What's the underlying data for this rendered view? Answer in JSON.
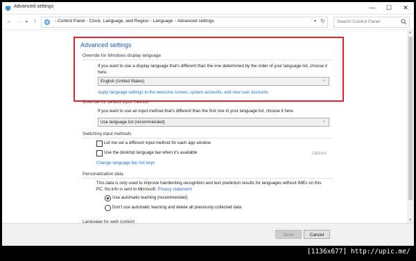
{
  "window": {
    "title": "Advanced settings"
  },
  "address_bar": {
    "breadcrumbs": [
      "Control Panel",
      "Clock, Language, and Region",
      "Language",
      "Advanced settings"
    ],
    "search_placeholder": "Search Control Panel"
  },
  "main": {
    "heading": "Advanced settings",
    "display_language": {
      "title": "Override for Windows display language",
      "description": "If you want to use a display language that's different than the one determined by the order of your language list, choose it here.",
      "selected": "English (United States)",
      "link": "Apply language settings to the welcome screen, system accounts, and new user accounts"
    },
    "input_method": {
      "title": "Override for default input method",
      "description": "If you want to use an input method that's different than the first one in your language list, choose it here.",
      "selected": "Use language list (recommended)"
    },
    "switching": {
      "title": "Switching input methods",
      "option1": "Let me set a different input method for each app window",
      "option2": "Use the desktop language bar when it's available",
      "options_link": "Options",
      "hotkeys_link": "Change language bar hot keys"
    },
    "personalization": {
      "title": "Personalization data",
      "description_line1": "This data is only used to improve handwriting recognition and text prediction results for languages without IMEs on this",
      "description_line2": "PC. No info is sent to Microsoft.",
      "privacy_link": "Privacy statement",
      "radio1": "Use automatic learning (recommended)",
      "radio2": "Don't use automatic learning and delete all previously collected data"
    },
    "web_content": {
      "title": "Language for web content"
    }
  },
  "footer": {
    "save_label": "Save",
    "cancel_label": "Cancel"
  },
  "watermark": "[1136x677] http://upic.me/",
  "colors": {
    "highlight": "#e0202a",
    "link": "#1e6fc8",
    "heading": "#1e5ba8"
  }
}
